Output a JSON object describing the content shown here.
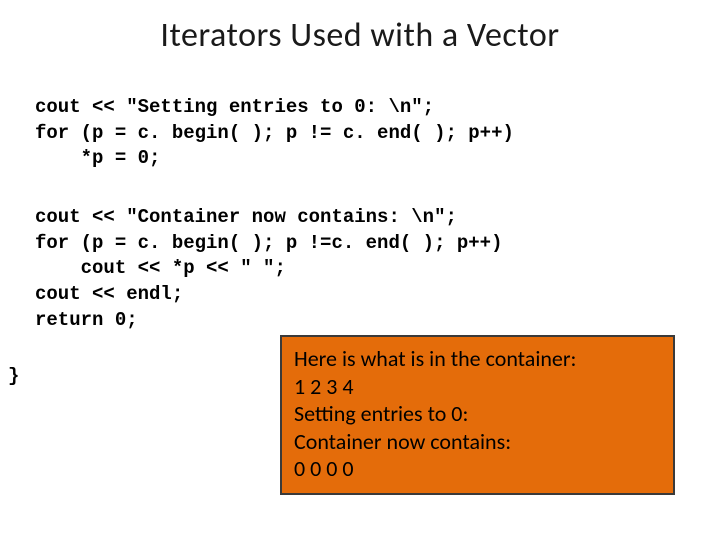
{
  "title": "Iterators Used with a Vector",
  "code": {
    "block1": "cout << \"Setting entries to 0: \\n\";\nfor (p = c. begin( ); p != c. end( ); p++)\n    *p = 0;",
    "block2": "cout << \"Container now contains: \\n\";\nfor (p = c. begin( ); p !=c. end( ); p++)\n    cout << *p << \" \";\ncout << endl;\nreturn 0;",
    "close": "}"
  },
  "output": {
    "line1": "Here is what is in the container:",
    "line2": "1 2 3 4",
    "line3": "Setting entries to 0:",
    "line4": "Container now contains:",
    "line5": "0 0 0 0"
  }
}
